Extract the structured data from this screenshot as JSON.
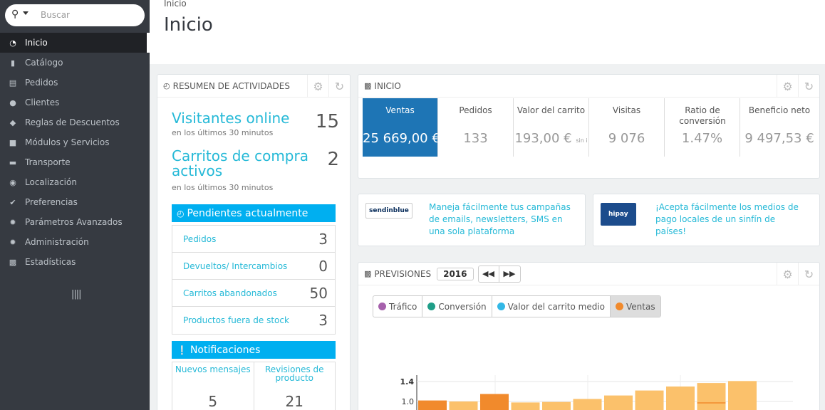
{
  "search": {
    "placeholder": "Buscar"
  },
  "nav": {
    "items": [
      {
        "label": "Inicio",
        "active": true
      },
      {
        "label": "Catálogo"
      },
      {
        "label": "Pedidos"
      },
      {
        "label": "Clientes"
      },
      {
        "label": "Reglas de Descuentos"
      },
      {
        "label": "Módulos y Servicios"
      },
      {
        "label": "Transporte"
      },
      {
        "label": "Localización"
      },
      {
        "label": "Preferencias"
      },
      {
        "label": "Parámetros Avanzados"
      },
      {
        "label": "Administración"
      },
      {
        "label": "Estadísticas"
      }
    ],
    "collapse": "||||"
  },
  "header": {
    "breadcrumb": "Inicio",
    "title": "Inicio"
  },
  "activity": {
    "title": "RESUMEN DE ACTIVIDADES",
    "online_label": "Visitantes online",
    "online_sub": "en los últimos 30 minutos",
    "online_value": "15",
    "carts_label": "Carritos de compra activos",
    "carts_sub": "en los últimos 30 minutos",
    "carts_value": "2",
    "pending_title": "Pendientes actualmente",
    "pending": [
      {
        "label": "Pedidos",
        "value": "3"
      },
      {
        "label": "Devueltos/ Intercambios",
        "value": "0"
      },
      {
        "label": "Carritos abandonados",
        "value": "50"
      },
      {
        "label": "Productos fuera de stock",
        "value": "3"
      }
    ],
    "notif_title": "Notificaciones",
    "notifications": [
      {
        "label": "Nuevos mensajes",
        "value": "5"
      },
      {
        "label": "Revisiones de producto",
        "value": "21"
      }
    ]
  },
  "dashboard": {
    "title": "INICIO",
    "kpis": [
      {
        "label": "Ventas",
        "value": "25 669,00 €",
        "small": "",
        "selected": true
      },
      {
        "label": "Pedidos",
        "value": "133",
        "small": ""
      },
      {
        "label": "Valor del carrito",
        "value": "193,00 €",
        "small": "sin i"
      },
      {
        "label": "Visitas",
        "value": "9 076",
        "small": ""
      },
      {
        "label": "Ratio de conversión",
        "value": "1.47%",
        "small": ""
      },
      {
        "label": "Beneficio neto",
        "value": "9 497,53 €",
        "small": ""
      }
    ]
  },
  "ads": [
    {
      "logo": "sendinblue",
      "text": "Maneja fácilmente tus campañas de emails, newsletters, SMS en una sola plataforma"
    },
    {
      "logo": "hipay",
      "text": "¡Acepta fácilmente los medios de pago locales de un sinfín de países!"
    }
  ],
  "forecast": {
    "title": "PREVISIONES",
    "year": "2016",
    "legend": [
      {
        "label": "Tráfico",
        "color": "#a661ac"
      },
      {
        "label": "Conversión",
        "color": "#1f9e88"
      },
      {
        "label": "Valor del carrito medio",
        "color": "#33b8e6"
      },
      {
        "label": "Ventas",
        "color": "#f18a2c",
        "active": true
      }
    ]
  },
  "chart_data": {
    "type": "bar",
    "visible_y_ticks": [
      "1.4",
      "1.0"
    ],
    "ylim": [
      0,
      1.4
    ],
    "series": [
      {
        "values": [
          1.02,
          1.0,
          1.15,
          0.98,
          0.99,
          1.05,
          1.12,
          1.22,
          1.3,
          1.37,
          1.41
        ]
      }
    ],
    "colors": {
      "dark": "#f18a2c",
      "light": "#fbc16b"
    }
  }
}
